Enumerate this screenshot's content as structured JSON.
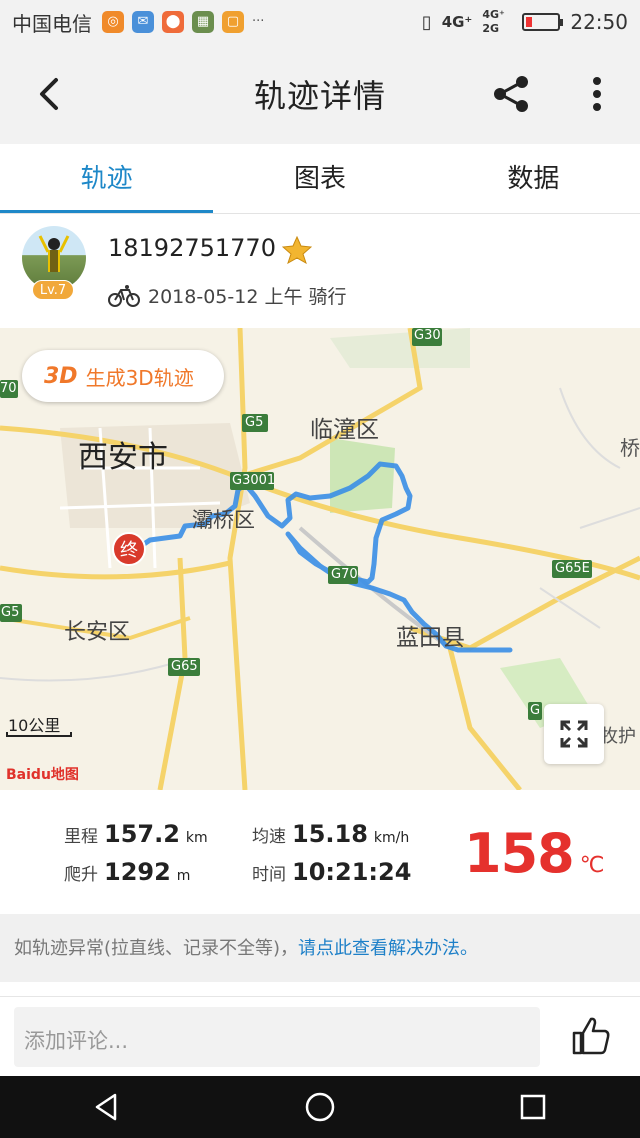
{
  "status_bar": {
    "carrier": "中国电信",
    "network": "4G⁺",
    "network2": "4G⁺ 2G",
    "dots": "···",
    "time": "22:50"
  },
  "header": {
    "title": "轨迹详情"
  },
  "tabs": [
    {
      "label": "轨迹"
    },
    {
      "label": "图表"
    },
    {
      "label": "数据"
    }
  ],
  "user": {
    "name": "18192751770",
    "level": "Lv.7",
    "meta": "2018-05-12 上午 骑行"
  },
  "map": {
    "button_3d": {
      "prefix": "3D",
      "label": "生成3D轨迹"
    },
    "labels": {
      "xian": "西安市",
      "baqiao": "灞桥区",
      "lintong": "临潼区",
      "changan": "长安区",
      "lantian": "蓝田县",
      "qiao": "桥",
      "mu": "牧护"
    },
    "road_shields": {
      "g30": "G30",
      "g5": "G5",
      "g3001": "G3001",
      "g70": "G70",
      "g65e": "G65E",
      "g5b": "G5",
      "g65": "G65",
      "s70": "70",
      "g_edge": "G"
    },
    "end_marker": "终",
    "scale": "10公里",
    "logo": "Baidu地图"
  },
  "stats": {
    "distance": {
      "label": "里程",
      "value": "157.2",
      "unit": "km"
    },
    "speed": {
      "label": "均速",
      "value": "15.18",
      "unit": "km/h"
    },
    "climb": {
      "label": "爬升",
      "value": "1292",
      "unit": "m"
    },
    "time": {
      "label": "时间",
      "value": "10:21:24"
    },
    "calorie": {
      "value": "158",
      "unit": "℃"
    }
  },
  "notice": {
    "text": "如轨迹异常(拉直线、记录不全等)，",
    "link": "请点此查看解决办法。"
  },
  "comment": {
    "placeholder": "添加评论..."
  },
  "colors": {
    "accent": "#1e88c8",
    "track": "#3a8ee6",
    "calorie": "#e5312d",
    "button3d": "#f0782a"
  }
}
